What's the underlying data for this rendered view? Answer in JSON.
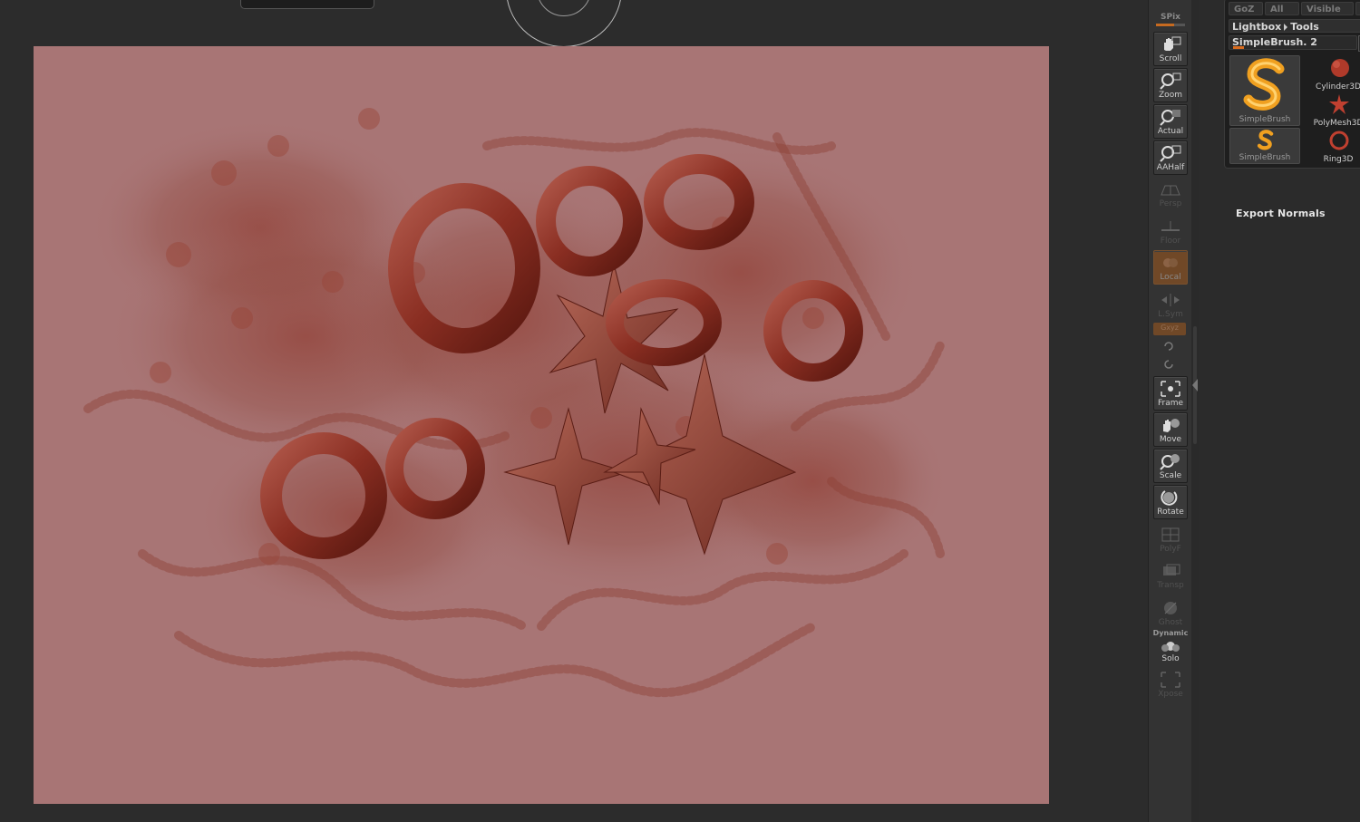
{
  "palette": {
    "row_buttons": [
      "GoZ",
      "All",
      "Visible"
    ],
    "lightbox": "Lightbox",
    "tools": "Tools",
    "tool_name": "SimpleBrush. 2",
    "thumbnails": [
      {
        "label": "SimpleBrush",
        "icon": "simplebrush-s-icon"
      },
      {
        "label": "SimpleBrush",
        "icon": "simplebrush-s-icon"
      }
    ],
    "tool_items": [
      {
        "label": "Cylinder3D",
        "icon": "cylinder3d-icon"
      },
      {
        "label": "PolyMesh3D",
        "icon": "polymesh3d-star-icon"
      },
      {
        "label": "Ring3D",
        "icon": "ring3d-icon"
      }
    ],
    "export_normals": "Export Normals"
  },
  "shelf": {
    "spix": "SPix",
    "buttons": [
      "Scroll",
      "Zoom",
      "Actual",
      "AAHalf",
      "Persp",
      "Floor",
      "Local",
      "L.Sym",
      "Frame",
      "Move",
      "Scale",
      "Rotate",
      "PolyF",
      "Transp",
      "Ghost",
      "Solo",
      "Xpose"
    ],
    "lsym_toggle": "Gxyz",
    "dynamic": "Dynamic"
  },
  "colors": {
    "canvas_bg": "#a87575",
    "accent_orange": "#d96c1f",
    "ui_bg": "#2b2b2b"
  }
}
